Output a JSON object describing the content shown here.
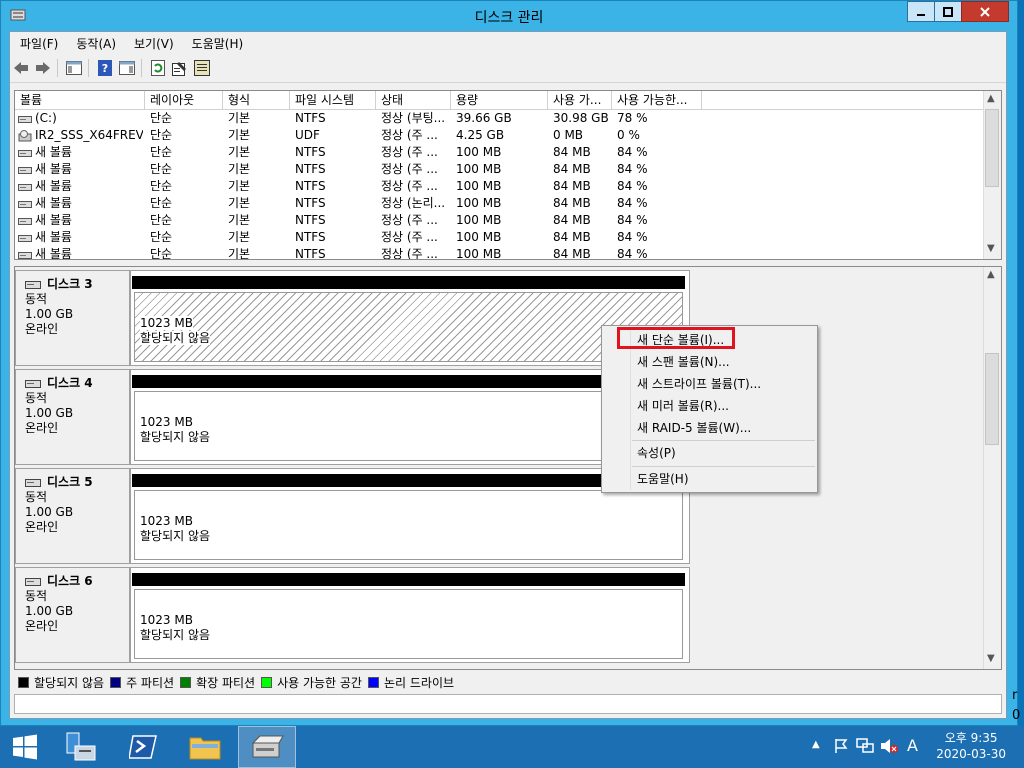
{
  "window": {
    "title": "디스크 관리"
  },
  "menu": [
    "파일(F)",
    "동작(A)",
    "보기(V)",
    "도움말(H)"
  ],
  "toolbar_icons": [
    "back-arrow-icon",
    "forward-arrow-icon",
    "console-tree-icon",
    "help-icon",
    "action-pane-icon",
    "refresh-icon",
    "properties-icon",
    "export-icon"
  ],
  "volume_table": {
    "columns": [
      "볼륨",
      "레이아웃",
      "형식",
      "파일 시스템",
      "상태",
      "용량",
      "사용 가...",
      "사용 가능한..."
    ],
    "rows": [
      [
        "(C:)",
        "단순",
        "기본",
        "NTFS",
        "정상 (부팅...",
        "39.66 GB",
        "30.98 GB",
        "78 %"
      ],
      [
        "IR2_SSS_X64FREV...",
        "단순",
        "기본",
        "UDF",
        "정상 (주 ...",
        "4.25 GB",
        "0 MB",
        "0 %"
      ],
      [
        "새 볼륨",
        "단순",
        "기본",
        "NTFS",
        "정상 (주 ...",
        "100 MB",
        "84 MB",
        "84 %"
      ],
      [
        "새 볼륨",
        "단순",
        "기본",
        "NTFS",
        "정상 (주 ...",
        "100 MB",
        "84 MB",
        "84 %"
      ],
      [
        "새 볼륨",
        "단순",
        "기본",
        "NTFS",
        "정상 (주 ...",
        "100 MB",
        "84 MB",
        "84 %"
      ],
      [
        "새 볼륨",
        "단순",
        "기본",
        "NTFS",
        "정상 (논리...",
        "100 MB",
        "84 MB",
        "84 %"
      ],
      [
        "새 볼륨",
        "단순",
        "기본",
        "NTFS",
        "정상 (주 ...",
        "100 MB",
        "84 MB",
        "84 %"
      ],
      [
        "새 볼륨",
        "단순",
        "기본",
        "NTFS",
        "정상 (주 ...",
        "100 MB",
        "84 MB",
        "84 %"
      ],
      [
        "새 볼륨",
        "단순",
        "기본",
        "NTFS",
        "정상 (주 ...",
        "100 MB",
        "84 MB",
        "84 %"
      ]
    ]
  },
  "disks": [
    {
      "name": "디스크 3",
      "type": "동적",
      "size": "1.00 GB",
      "status": "온라인",
      "part_size": "1023 MB",
      "part_status": "할당되지 않음"
    },
    {
      "name": "디스크 4",
      "type": "동적",
      "size": "1.00 GB",
      "status": "온라인",
      "part_size": "1023 MB",
      "part_status": "할당되지 않음"
    },
    {
      "name": "디스크 5",
      "type": "동적",
      "size": "1.00 GB",
      "status": "온라인",
      "part_size": "1023 MB",
      "part_status": "할당되지 않음"
    },
    {
      "name": "디스크 6",
      "type": "동적",
      "size": "1.00 GB",
      "status": "온라인",
      "part_size": "1023 MB",
      "part_status": "할당되지 않음"
    }
  ],
  "legend": [
    {
      "label": "할당되지 않음",
      "color": "#000000"
    },
    {
      "label": "주 파티션",
      "color": "#000080"
    },
    {
      "label": "확장 파티션",
      "color": "#008000"
    },
    {
      "label": "사용 가능한 공간",
      "color": "#00ff00"
    },
    {
      "label": "논리 드라이브",
      "color": "#0000ff"
    }
  ],
  "context_menu": {
    "new_simple": "새 단순 볼륨(I)...",
    "new_spanned": "새 스팬 볼륨(N)...",
    "new_striped": "새 스트라이프 볼륨(T)...",
    "new_mirrored": "새 미러 볼륨(R)...",
    "new_raid5": "새 RAID-5 볼륨(W)...",
    "properties": "속성(P)",
    "help": "도움말(H)"
  },
  "taskbar": {
    "clock_time": "오후 9:35",
    "clock_date": "2020-03-30",
    "ime": "A"
  },
  "edge_text": {
    "line1": "r",
    "line2": "0"
  }
}
